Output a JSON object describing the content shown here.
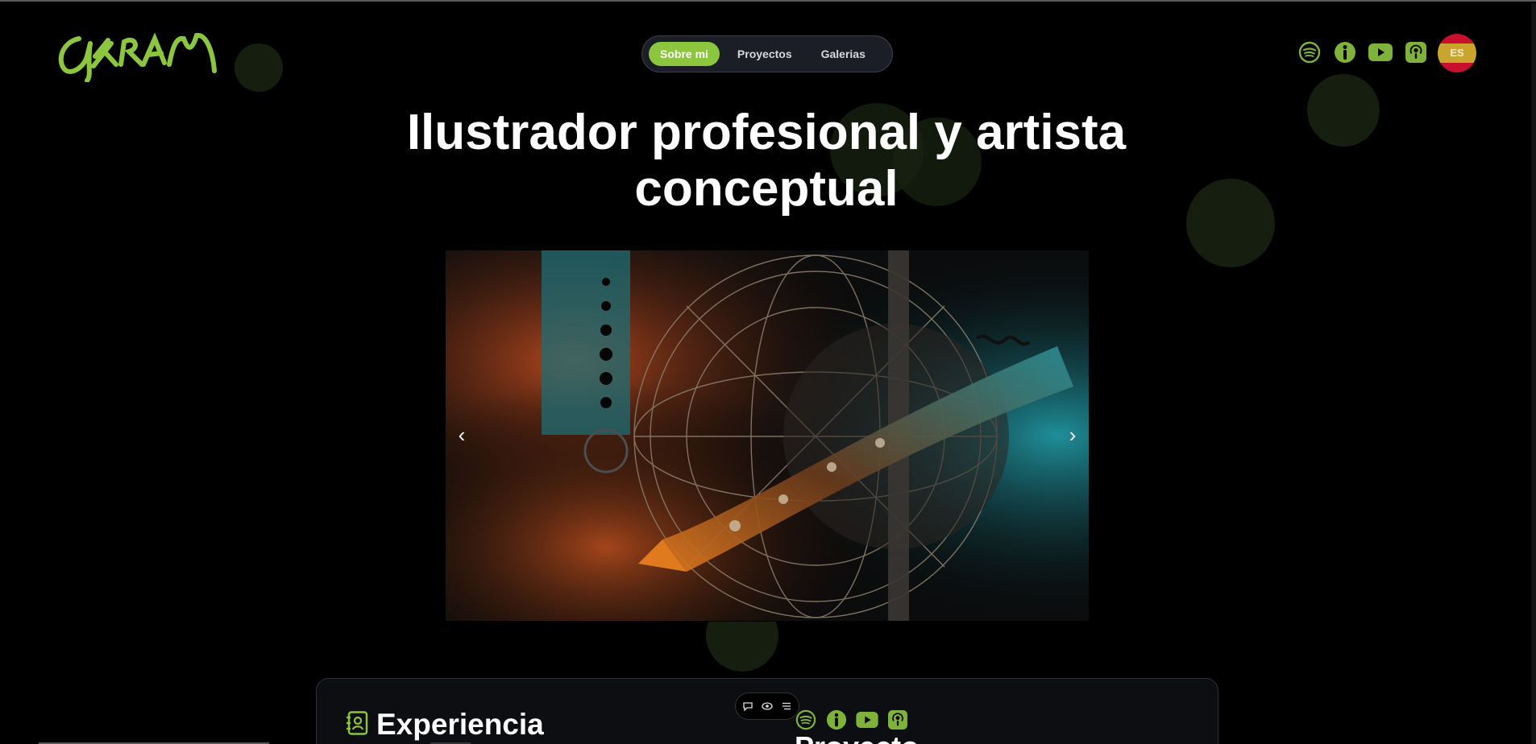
{
  "brand": {
    "logo_text": "YKRAM",
    "accent_color": "#8cc63f"
  },
  "nav": {
    "items": [
      {
        "label": "Sobre mi",
        "active": true
      },
      {
        "label": "Proyectos",
        "active": false
      },
      {
        "label": "Galerias",
        "active": false
      }
    ]
  },
  "header_icons": [
    "spotify-icon",
    "info-icon",
    "youtube-icon",
    "podcast-icon"
  ],
  "language": {
    "code": "ES"
  },
  "hero": {
    "title_line1": "Ilustrador profesional y artista",
    "title_line2": "conceptual"
  },
  "carousel": {
    "prev_label": "‹",
    "next_label": "›"
  },
  "section": {
    "experience_title": "Experiencia",
    "cut_heading": "Proyecto"
  },
  "mini_toolbar": [
    "comment-icon",
    "eye-icon",
    "menu-icon"
  ]
}
